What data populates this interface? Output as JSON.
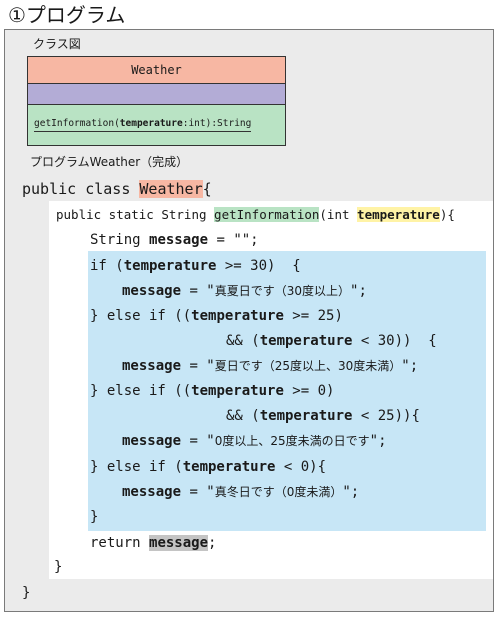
{
  "title": "①プログラム",
  "class_diagram": {
    "label": "クラス図",
    "class_name": "Weather",
    "operation_prefix": "getInformation(",
    "operation_param": "temperature",
    "operation_suffix": ":int):String"
  },
  "program": {
    "label": "プログラムWeather（完成）",
    "class_decl_prefix": "public class ",
    "class_decl_name": "Weather",
    "class_decl_brace": "{",
    "method_prefix": "public static String ",
    "method_name": "getInformation",
    "method_param_type": "(int ",
    "method_param_name": "temperature",
    "method_suffix": "){",
    "line_decl": "String ",
    "line_decl_var": "message",
    "line_decl_rest": " = \"\";",
    "if1_a": "if (",
    "if1_var": "temperature",
    "if1_b": " >= 30)  {",
    "assign1_var": "message",
    "assign1_eq": " = \"",
    "assign1_text": "真夏日です（30度以上）",
    "assign1_end": "\";",
    "else2_a": "} else if ((",
    "else2_var": "temperature",
    "else2_b": " >= 25)",
    "and2_a": "&& (",
    "and2_var": "temperature",
    "and2_b": " < 30))  {",
    "assign2_var": "message",
    "assign2_eq": " = \"",
    "assign2_text": "夏日です（25度以上、30度未満）",
    "assign2_end": "\";",
    "else3_a": "} else if ((",
    "else3_var": "temperature",
    "else3_b": " >= 0)",
    "and3_a": "&& (",
    "and3_var": "temperature",
    "and3_b": " < 25)){",
    "assign3_var": "message",
    "assign3_eq": " = \"",
    "assign3_text": "0度以上、25度未満の日です",
    "assign3_end": "\";",
    "else4_a": "} else if (",
    "else4_var": "temperature",
    "else4_b": " < 0){",
    "assign4_var": "message",
    "assign4_eq": " = \"",
    "assign4_text": "真冬日です（0度未満）",
    "assign4_end": "\";",
    "close_if": "}",
    "return_kw": "return ",
    "return_var": "message",
    "return_end": ";",
    "close_method": "}",
    "close_class": "}"
  }
}
